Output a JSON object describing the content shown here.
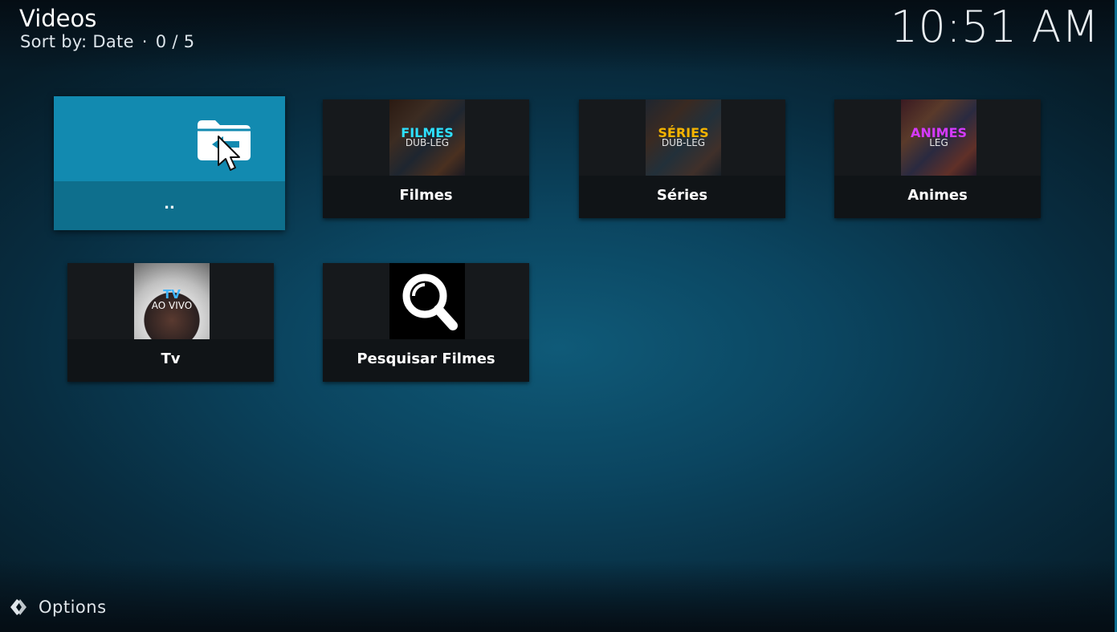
{
  "header": {
    "title": "Videos",
    "sort_label": "Sort by: Date",
    "separator": "·",
    "count": "0 / 5",
    "clock": "10:51 AM"
  },
  "tiles": [
    {
      "label": "..",
      "icon": "folder-back-icon"
    },
    {
      "label": "Filmes",
      "thumb_line1": "FILMES",
      "thumb_line2": "DUB-LEG"
    },
    {
      "label": "Séries",
      "thumb_line1": "SÉRIES",
      "thumb_line2": "DUB-LEG"
    },
    {
      "label": "Animes",
      "thumb_line1": "ANIMES",
      "thumb_line2": "LEG"
    },
    {
      "label": "Tv",
      "thumb_line1": "TV",
      "thumb_line2": "AO VIVO"
    },
    {
      "label": "Pesquisar Filmes",
      "icon": "search-icon"
    }
  ],
  "footer": {
    "options_label": "Options",
    "icon": "options-icon"
  },
  "colors": {
    "focus": "#128ab0",
    "filmes_text": "#2ee0ff",
    "series_text": "#f5b400",
    "animes_text": "#d53aff",
    "tv_text": "#3fb6ff"
  }
}
